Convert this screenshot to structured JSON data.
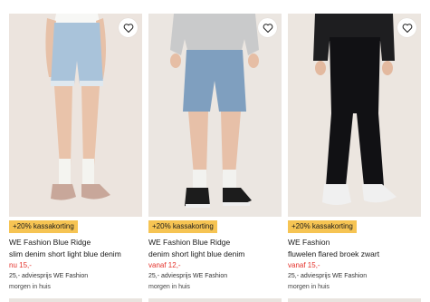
{
  "products": [
    {
      "badge": "+20% kassakorting",
      "brand": "WE Fashion Blue Ridge",
      "name": "slim denim short light blue denim",
      "price": "nu 15,-",
      "advice": "25,- adviesprijs WE Fashion",
      "delivery": "morgen in huis",
      "favorite_icon": "heart-outline-icon"
    },
    {
      "badge": "+20% kassakorting",
      "brand": "WE Fashion Blue Ridge",
      "name": "denim short light blue denim",
      "price": "vanaf 12,-",
      "advice": "25,- adviesprijs WE Fashion",
      "delivery": "morgen in huis",
      "favorite_icon": "heart-outline-icon"
    },
    {
      "badge": "+20% kassakorting",
      "brand": "WE Fashion",
      "name": "fluwelen flared broek zwart",
      "price": "vanaf 15,-",
      "advice": "25,- adviesprijs WE Fashion",
      "delivery": "morgen in huis",
      "favorite_icon": "heart-outline-icon"
    }
  ],
  "colors": {
    "badge_bg": "#f6c453",
    "price_red": "#e4322b",
    "photo_bg": "#ebe5df"
  }
}
